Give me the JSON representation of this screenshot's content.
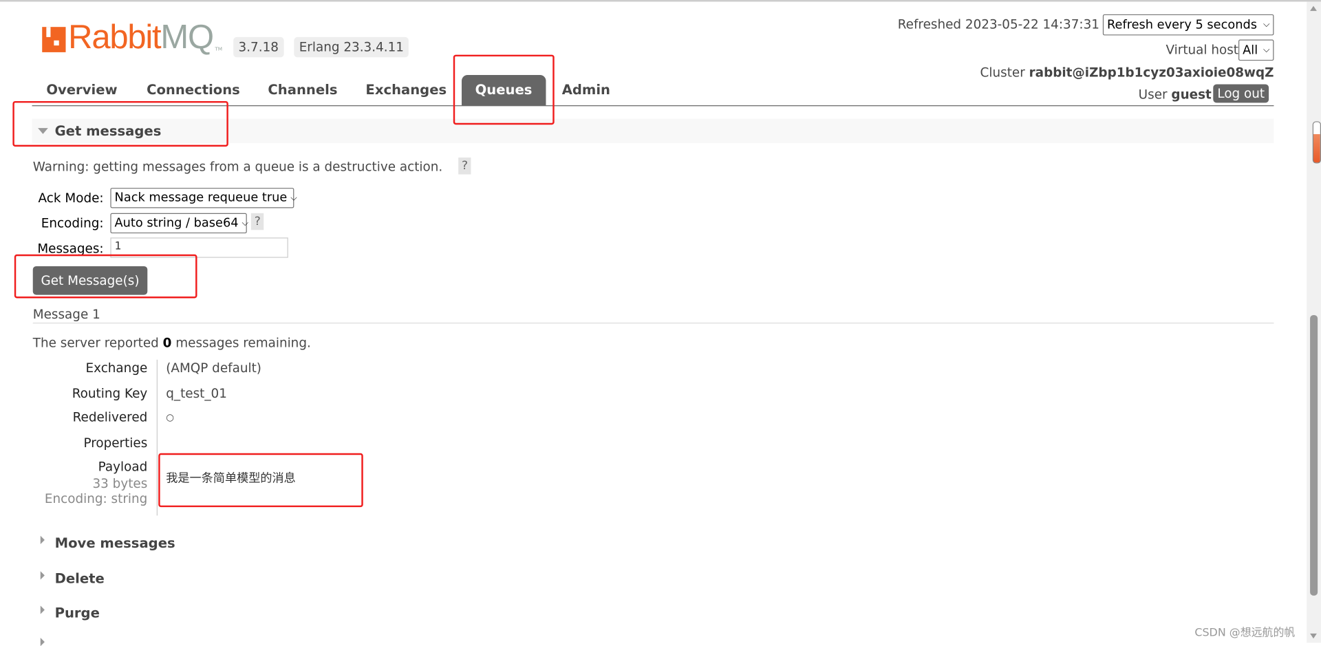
{
  "header": {
    "logo_text": "RabbitMQ",
    "version": "3.7.18",
    "erlang": "Erlang 23.3.4.11",
    "refreshed_label": "Refreshed 2023-05-22 14:37:31",
    "refresh_select": "Refresh every 5 seconds",
    "vhost_label": "Virtual host",
    "vhost_select": "All",
    "cluster_label": "Cluster",
    "cluster_name": "rabbit@iZbp1b1cyz03axioie08wqZ",
    "user_label": "User",
    "user_name": "guest",
    "logout": "Log out"
  },
  "tabs": [
    {
      "label": "Overview",
      "active": false
    },
    {
      "label": "Connections",
      "active": false
    },
    {
      "label": "Channels",
      "active": false
    },
    {
      "label": "Exchanges",
      "active": false
    },
    {
      "label": "Queues",
      "active": true
    },
    {
      "label": "Admin",
      "active": false
    }
  ],
  "get_messages": {
    "title": "Get messages",
    "warning": "Warning: getting messages from a queue is a destructive action.",
    "help": "?",
    "ack_mode_label": "Ack Mode:",
    "ack_mode_value": "Nack message requeue true",
    "encoding_label": "Encoding:",
    "encoding_value": "Auto string / base64",
    "messages_label": "Messages:",
    "messages_value": "1",
    "button": "Get Message(s)"
  },
  "result": {
    "heading": "Message 1",
    "remaining_pre": "The server reported",
    "remaining_count": "0",
    "remaining_post": "messages remaining.",
    "rows": [
      {
        "label": "Exchange",
        "value": "(AMQP default)"
      },
      {
        "label": "Routing Key",
        "value": "q_test_01"
      },
      {
        "label": "Redelivered",
        "value": "○"
      },
      {
        "label": "Properties",
        "value": ""
      }
    ],
    "payload_label": "Payload",
    "payload_size": "33 bytes",
    "payload_encoding": "Encoding: string",
    "payload_value": "我是一条简单模型的消息"
  },
  "sections": [
    "Move messages",
    "Delete",
    "Purge"
  ],
  "watermark": "CSDN @想远航的帆",
  "colors": {
    "brand_orange": "#f26522",
    "tab_active": "#666666",
    "annotation_red": "#f01d1d"
  }
}
